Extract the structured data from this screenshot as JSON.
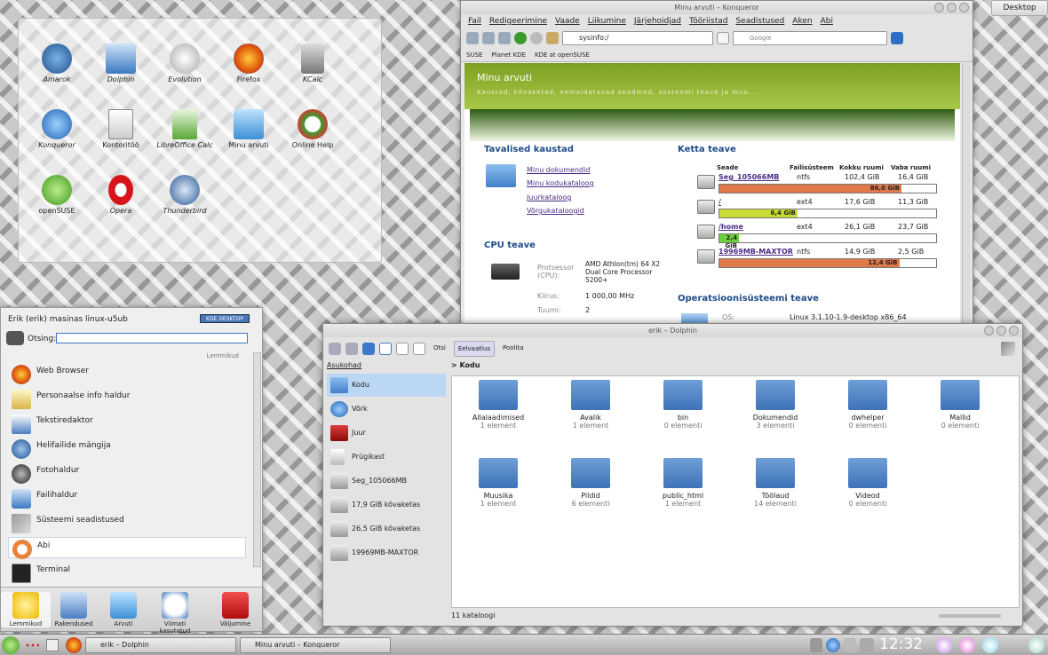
{
  "desktop": {
    "icons": [
      "Amarok",
      "Dolphin",
      "Evolution",
      "Firefox",
      "KCalc",
      "Konqueror",
      "Kontoritöö",
      "LibreOffice Calc",
      "Minu arvuti",
      "Online Help",
      "openSUSE",
      "Opera",
      "Thunderbird"
    ],
    "desktop_button": "Desktop"
  },
  "konqueror": {
    "title": "Minu arvuti – Konqueror",
    "menu": [
      "Fail",
      "Redigeerimine",
      "Vaade",
      "Liikumine",
      "Järjehoidjad",
      "Tööriistad",
      "Seadistused",
      "Aken",
      "Abi"
    ],
    "url": "sysinfo:/",
    "search_placeholder": "Google",
    "bookmarks": [
      "SUSE",
      "Planet KDE",
      "KDE at openSUSE"
    ],
    "page_title": "Minu arvuti",
    "page_subtitle": "Kaustad, kõvaketad, eemaldatavad seadmed, süsteemi teave ja muu...",
    "folders_title": "Tavalised kaustad",
    "folders": [
      "Minu dokumendid",
      "Minu kodukataloog",
      "Juurkataloog",
      "Võrgukataloogid"
    ],
    "cpu_title": "CPU teave",
    "cpu": {
      "proc_label": "Protsessor (CPU):",
      "proc_value": "AMD Athlon(tm) 64 X2 Dual Core Processor 5200+",
      "speed_label": "Kiirus:",
      "speed_value": "1 000,00 MHz",
      "cores_label": "Tuumi:",
      "cores_value": "2"
    },
    "disk_title": "Ketta teave",
    "disk_headers": [
      "Seade",
      "Failisüsteem",
      "Kokku ruumi",
      "Vaba ruumi"
    ],
    "disks": [
      {
        "name": "Seg_105066MB",
        "fs": "ntfs",
        "total": "102,4 GiB",
        "free": "16,4 GiB",
        "used": "86,0 GiB",
        "fill": 0.84,
        "color": "#e07a4a"
      },
      {
        "name": "/",
        "fs": "ext4",
        "total": "17,6 GiB",
        "free": "11,3 GiB",
        "used": "6,4 GiB",
        "fill": 0.36,
        "color": "#c9dc36"
      },
      {
        "name": "/home",
        "fs": "ext4",
        "total": "26,1 GiB",
        "free": "23,7 GiB",
        "used": "2,4 GiB",
        "fill": 0.09,
        "color": "#6bd03a"
      },
      {
        "name": "19969MB-MAXTOR",
        "fs": "ntfs",
        "total": "14,9 GiB",
        "free": "2,5 GiB",
        "used": "12,4 GiB",
        "fill": 0.83,
        "color": "#e07a4a"
      }
    ],
    "os_title": "Operatsioonisüsteemi teave",
    "os_label": "OS:",
    "os_value": "Linux 3.1.10-1.9-desktop x86_64"
  },
  "kickoff": {
    "user": "Erik (erik) masinas linux-u5ub",
    "badge": "KDE DESKTOP",
    "search_label": "Otsing:",
    "section": "Lemmikud",
    "items": [
      "Web Browser",
      "Personaalse info haldur",
      "Tekstiredaktor",
      "Helifailide mängija",
      "Fotohaldur",
      "Failihaldur",
      "Süsteemi seadistused",
      "Abi",
      "Terminal"
    ],
    "tabs": [
      "Lemmikud",
      "Rakendused",
      "Arvuti",
      "Viimati kasutatud",
      "Väljumine"
    ]
  },
  "dolphin": {
    "title": "erik – Dolphin",
    "search": "Otsi",
    "preview": "Eelvaatlus",
    "split": "Poolita",
    "places_title": "Asukohad",
    "places": [
      "Kodu",
      "Võrk",
      "Juur",
      "Prügikast",
      "Seg_105066MB",
      "17,9 GiB kõvaketas",
      "26,5 GiB kõvaketas",
      "19969MB-MAXTOR"
    ],
    "breadcrumb": "Kodu",
    "files": [
      {
        "name": "Allalaadimised",
        "sub": "1 element"
      },
      {
        "name": "Avalik",
        "sub": "1 element"
      },
      {
        "name": "bin",
        "sub": "0 elementi"
      },
      {
        "name": "Dokumendid",
        "sub": "3 elementi"
      },
      {
        "name": "dwhelper",
        "sub": "0 elementi"
      },
      {
        "name": "Mallid",
        "sub": "0 elementi"
      },
      {
        "name": "Muusika",
        "sub": "1 element"
      },
      {
        "name": "Pildid",
        "sub": "6 elementi"
      },
      {
        "name": "public_html",
        "sub": "1 element"
      },
      {
        "name": "Töölaud",
        "sub": "14 elementi"
      },
      {
        "name": "Videod",
        "sub": "0 elementi"
      }
    ],
    "status": "11 kataloogi"
  },
  "taskbar": {
    "tasks": [
      "erik – Dolphin",
      "Minu arvuti – Konqueror"
    ],
    "clock": "12:32"
  }
}
